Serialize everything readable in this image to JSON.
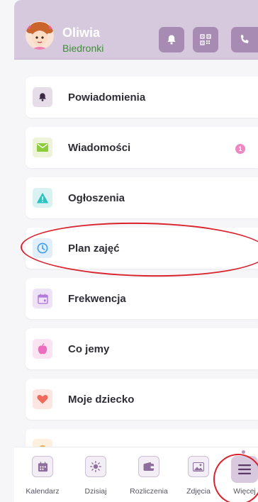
{
  "header": {
    "name": "Oliwia",
    "group": "Biedronki",
    "icons": [
      "bell-icon",
      "qr-code-icon",
      "phone-icon"
    ]
  },
  "menu": [
    {
      "label": "Powiadomienia",
      "icon": "bell-icon",
      "color": "#3b2a45",
      "bg": "#e6dde9"
    },
    {
      "label": "Wiadomości",
      "icon": "envelope-icon",
      "color": "#8ccd3c",
      "bg": "#edf4d9",
      "badge": "1"
    },
    {
      "label": "Ogłoszenia",
      "icon": "warning-icon",
      "color": "#29c3c3",
      "bg": "#daf3f2"
    },
    {
      "label": "Plan zajęć",
      "icon": "clock-icon",
      "color": "#3b9bf0",
      "bg": "#e1effb"
    },
    {
      "label": "Frekwencja",
      "icon": "calendar-icon",
      "color": "#b27ad8",
      "bg": "#eee2f7"
    },
    {
      "label": "Co jemy",
      "icon": "apple-icon",
      "color": "#ec6fbf",
      "bg": "#fbe4f2"
    },
    {
      "label": "Moje dziecko",
      "icon": "heart-icon",
      "color": "#f06a5c",
      "bg": "#fde6e1"
    }
  ],
  "tabs": [
    {
      "label": "Kalendarz",
      "icon": "calendar-icon"
    },
    {
      "label": "Dzisiaj",
      "icon": "sun-icon"
    },
    {
      "label": "Rozliczenia",
      "icon": "wallet-icon"
    },
    {
      "label": "Zdjęcia",
      "icon": "image-icon"
    },
    {
      "label": "Więcej",
      "icon": "menu-icon"
    }
  ],
  "colors": {
    "header_bg": "#d7c9dd",
    "accent": "#a78bb3",
    "group_text": "#3e8e3a",
    "badge": "#ee88c2",
    "annotation": "#d9232e"
  }
}
